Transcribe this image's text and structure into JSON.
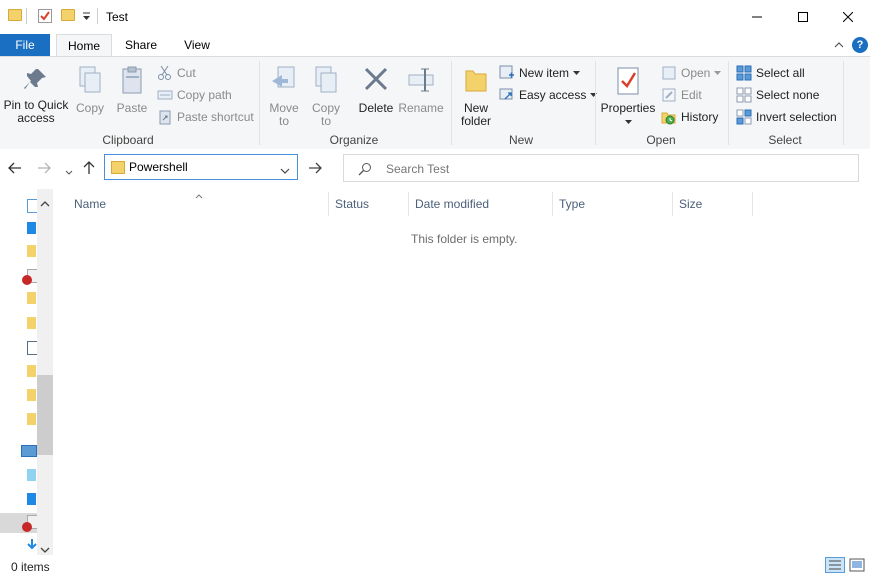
{
  "window": {
    "title": "Test"
  },
  "tabs": {
    "file": "File",
    "home": "Home",
    "share": "Share",
    "view": "View"
  },
  "ribbon": {
    "clipboard": {
      "label": "Clipboard",
      "pin": "Pin to Quick access",
      "copy": "Copy",
      "paste": "Paste",
      "cut": "Cut",
      "copy_path": "Copy path",
      "paste_shortcut": "Paste shortcut"
    },
    "organize": {
      "label": "Organize",
      "move_to": "Move to",
      "copy_to": "Copy to",
      "delete": "Delete",
      "rename": "Rename"
    },
    "new": {
      "label": "New",
      "new_folder": "New folder",
      "new_item": "New item",
      "easy_access": "Easy access"
    },
    "open": {
      "label": "Open",
      "properties": "Properties",
      "open": "Open",
      "edit": "Edit",
      "history": "History"
    },
    "select": {
      "label": "Select",
      "select_all": "Select all",
      "select_none": "Select none",
      "invert_selection": "Invert selection"
    }
  },
  "navigation": {
    "address_value": "Powershell",
    "search_placeholder": "Search Test"
  },
  "columns": [
    "Name",
    "Status",
    "Date modified",
    "Type",
    "Size"
  ],
  "content": {
    "empty_message": "This folder is empty."
  },
  "status": {
    "item_count": "0 items"
  },
  "colors": {
    "accent": "#1a6fc2",
    "folder": "#f4d26b"
  }
}
